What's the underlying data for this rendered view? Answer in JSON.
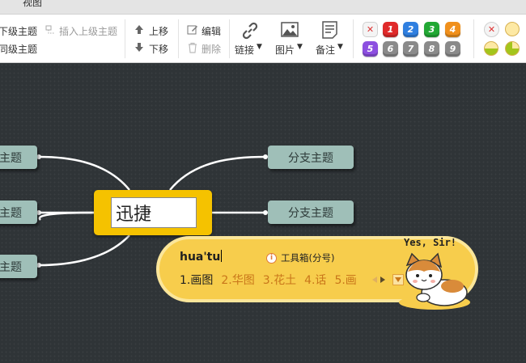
{
  "menu": {
    "view_tab": "视图"
  },
  "toolbar": {
    "subtopic": "下级主题",
    "sibling": "同级主题",
    "insert_parent": "插入上级主题",
    "move_up": "上移",
    "move_down": "下移",
    "edit": "编辑",
    "delete": "删除",
    "link": "链接",
    "image": "图片",
    "note": "备注"
  },
  "markers": {
    "priority": [
      "1",
      "2",
      "3",
      "4",
      "5",
      "6",
      "7",
      "8",
      "9"
    ],
    "colors": {
      "1": "#e02a2a",
      "2": "#2f7fe0",
      "3": "#22a834",
      "4": "#f0901c",
      "5": "#8c4fe0",
      "6": "#8a8a8a",
      "7": "#8a8a8a",
      "8": "#8a8a8a",
      "9": "#8a8a8a"
    }
  },
  "mindmap": {
    "center": "迅捷",
    "left_nodes": [
      "主题",
      "主题",
      "主题"
    ],
    "right_nodes": [
      "分支主题",
      "分支主题"
    ]
  },
  "ime": {
    "pinyin": "hua'tu",
    "toolbox": "工具箱(分号)",
    "candidates": [
      "1.画图",
      "2.华图",
      "3.花土",
      "4.话",
      "5.画"
    ],
    "mascot_text": "Yes, Sir!"
  }
}
